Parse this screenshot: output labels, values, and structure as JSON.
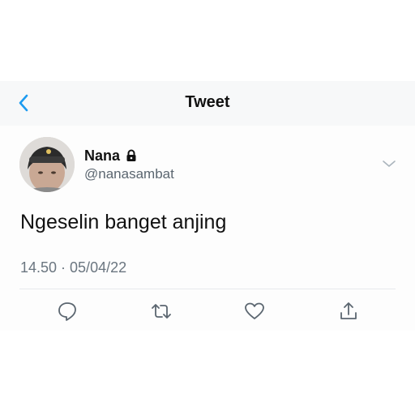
{
  "nav": {
    "title": "Tweet"
  },
  "tweet": {
    "author_name": "Nana",
    "handle": "@nanasambat",
    "text": "Ngeselin banget anjing",
    "timestamp": "14.50 · 05/04/22"
  },
  "icons": {
    "back": "chevron-left-icon",
    "lock": "lock-icon",
    "more": "chevron-down-icon",
    "reply": "reply-icon",
    "retweet": "retweet-icon",
    "like": "heart-icon",
    "share": "share-icon"
  },
  "colors": {
    "accent": "#1d9bf0",
    "icon_gray": "#5b6670",
    "text_primary": "#111111",
    "text_secondary": "#6b7680"
  }
}
